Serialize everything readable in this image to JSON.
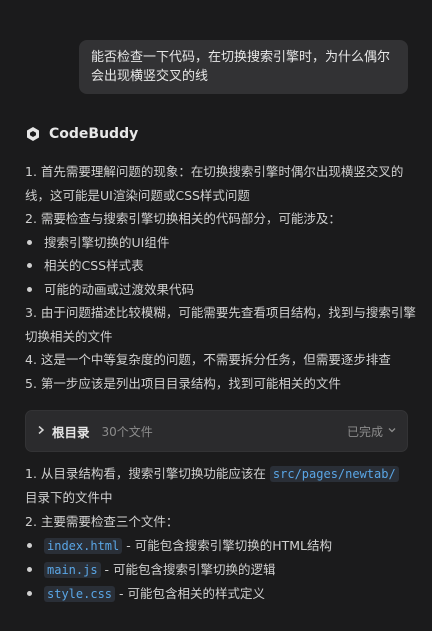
{
  "user_message": "能否检查一下代码，在切换搜索引擎时，为什么偶尔会出现横竖交叉的线",
  "assistant": {
    "name": "CodeBuddy",
    "steps": [
      "1. 首先需要理解问题的现象：在切换搜索引擎时偶尔出现横竖交叉的线，这可能是UI渲染问题或CSS样式问题",
      "2. 需要检查与搜索引擎切换相关的代码部分，可能涉及："
    ],
    "bullets": [
      "搜索引擎切换的UI组件",
      "相关的CSS样式表",
      "可能的动画或过渡效果代码"
    ],
    "steps2": [
      "3. 由于问题描述比较模糊，可能需要先查看项目结构，找到与搜索引擎切换相关的文件",
      "4. 这是一个中等复杂度的问题，不需要拆分任务，但需要逐步排查",
      "5. 第一步应该是列出项目目录结构，找到可能相关的文件"
    ]
  },
  "directory_card": {
    "title": "根目录",
    "count": "30个文件",
    "status": "已完成"
  },
  "followup": {
    "line1_prefix": "1. 从目录结构看，搜索引擎切换功能应该在",
    "line1_code": "src/pages/newtab/",
    "line1_suffix": "目录下的文件中",
    "line2": "2. 主要需要检查三个文件：",
    "files": [
      {
        "name": "index.html",
        "desc": " - 可能包含搜索引擎切换的HTML结构"
      },
      {
        "name": "main.js",
        "desc": " - 可能包含搜索引擎切换的逻辑"
      },
      {
        "name": "style.css",
        "desc": " - 可能包含相关的样式定义"
      }
    ]
  },
  "colors": {
    "background": "#1b1b1c",
    "bubble": "#323234",
    "code_text": "#5aa6e6",
    "code_bg": "#2a2f37"
  },
  "icons": {
    "logo": "codebuddy-logo-icon",
    "expand": "chevron-right-icon",
    "status": "chevron-down-icon"
  }
}
